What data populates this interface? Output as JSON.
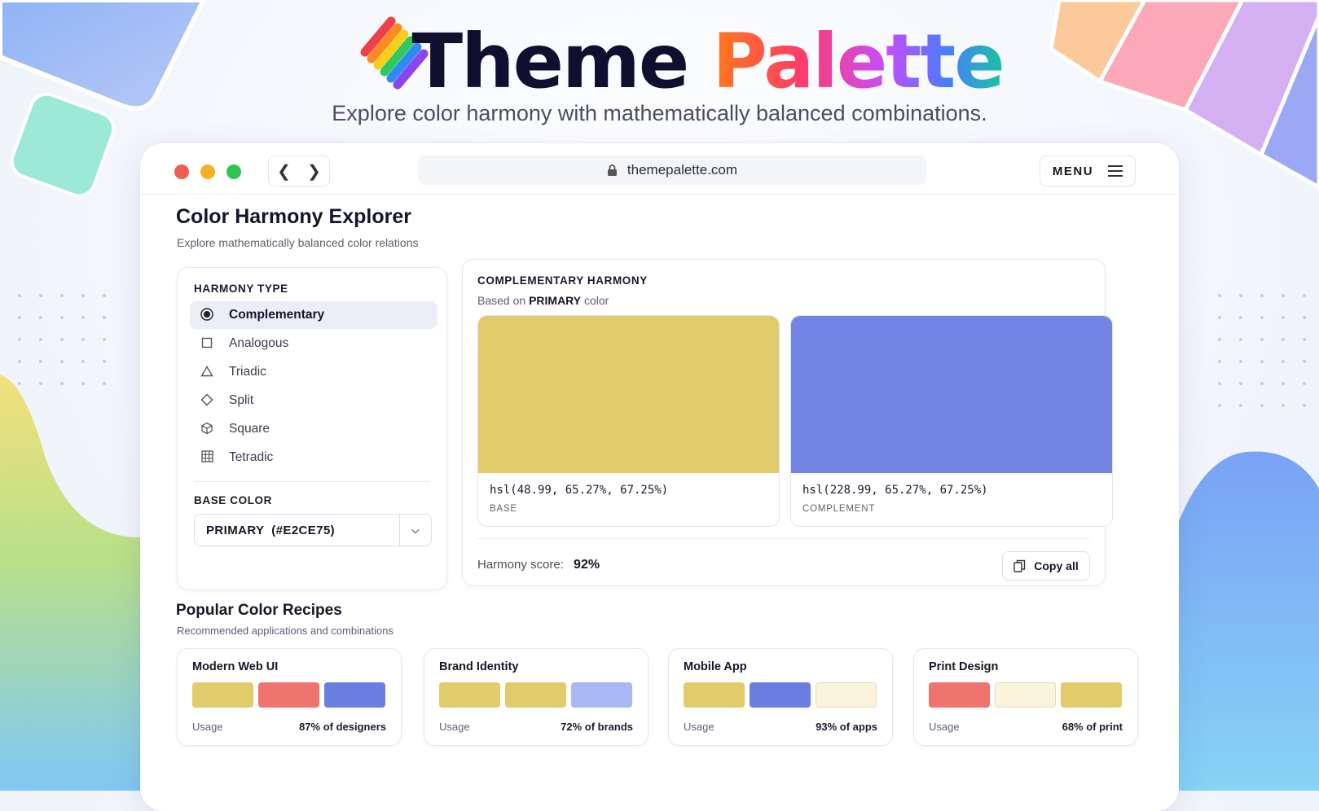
{
  "hero": {
    "title_dark": "Theme",
    "title_colored": "Palette",
    "subtitle": "Explore color harmony with mathematically balanced combinations."
  },
  "browser": {
    "url": "themepalette.com",
    "menu_label": "MENU",
    "back_icon": "chevron-left-icon",
    "forward_icon": "chevron-right-icon",
    "lock_icon": "lock-icon",
    "menu_icon": "hamburger-icon",
    "traffic_lights": [
      "#f25c54",
      "#f5b025",
      "#2ec552"
    ]
  },
  "page": {
    "title": "Color Harmony Explorer",
    "subtitle": "Explore mathematically balanced color relations"
  },
  "harmony_panel": {
    "heading": "HARMONY TYPE",
    "items": [
      {
        "label": "Complementary",
        "icon": "radio-selected-icon",
        "active": true
      },
      {
        "label": "Analogous",
        "icon": "square-icon",
        "active": false
      },
      {
        "label": "Triadic",
        "icon": "triangle-icon",
        "active": false
      },
      {
        "label": "Split",
        "icon": "diamond-icon",
        "active": false
      },
      {
        "label": "Square",
        "icon": "cube-icon",
        "active": false
      },
      {
        "label": "Tetradic",
        "icon": "grid-icon",
        "active": false
      }
    ],
    "base_color_heading": "BASE COLOR",
    "base_color_value": "PRIMARY  (#E2CE75)"
  },
  "result_panel": {
    "heading": "COMPLEMENTARY HARMONY",
    "based_on_prefix": "Based on",
    "based_on_strong": "PRIMARY",
    "based_on_suffix": "color",
    "swatches": [
      {
        "color": "#e2cb6b",
        "code": "hsl(48.99, 65.27%, 67.25%)",
        "role": "BASE"
      },
      {
        "color": "#7385e2",
        "code": "hsl(228.99, 65.27%, 67.25%)",
        "role": "COMPLEMENT"
      }
    ],
    "score_label": "Harmony score:",
    "score_value": "92%",
    "copy_label": "Copy all"
  },
  "recipes": {
    "title": "Popular Color Recipes",
    "subtitle": "Recommended applications and combinations",
    "usage_label": "Usage",
    "items": [
      {
        "name": "Modern Web UI",
        "colors": [
          "#e2cb6b",
          "#ef7470",
          "#6b7fe0"
        ],
        "usage": "87% of designers"
      },
      {
        "name": "Brand Identity",
        "colors": [
          "#e2cb6b",
          "#e2cb6b",
          "#a9b7f5"
        ],
        "usage": "72% of brands"
      },
      {
        "name": "Mobile App",
        "colors": [
          "#e2cb6b",
          "#6b7fe0",
          "#fbf4db"
        ],
        "usage": "93% of apps"
      },
      {
        "name": "Print Design",
        "colors": [
          "#ef7470",
          "#fbf4db",
          "#e2cb6b"
        ],
        "usage": "68% of print"
      }
    ]
  }
}
